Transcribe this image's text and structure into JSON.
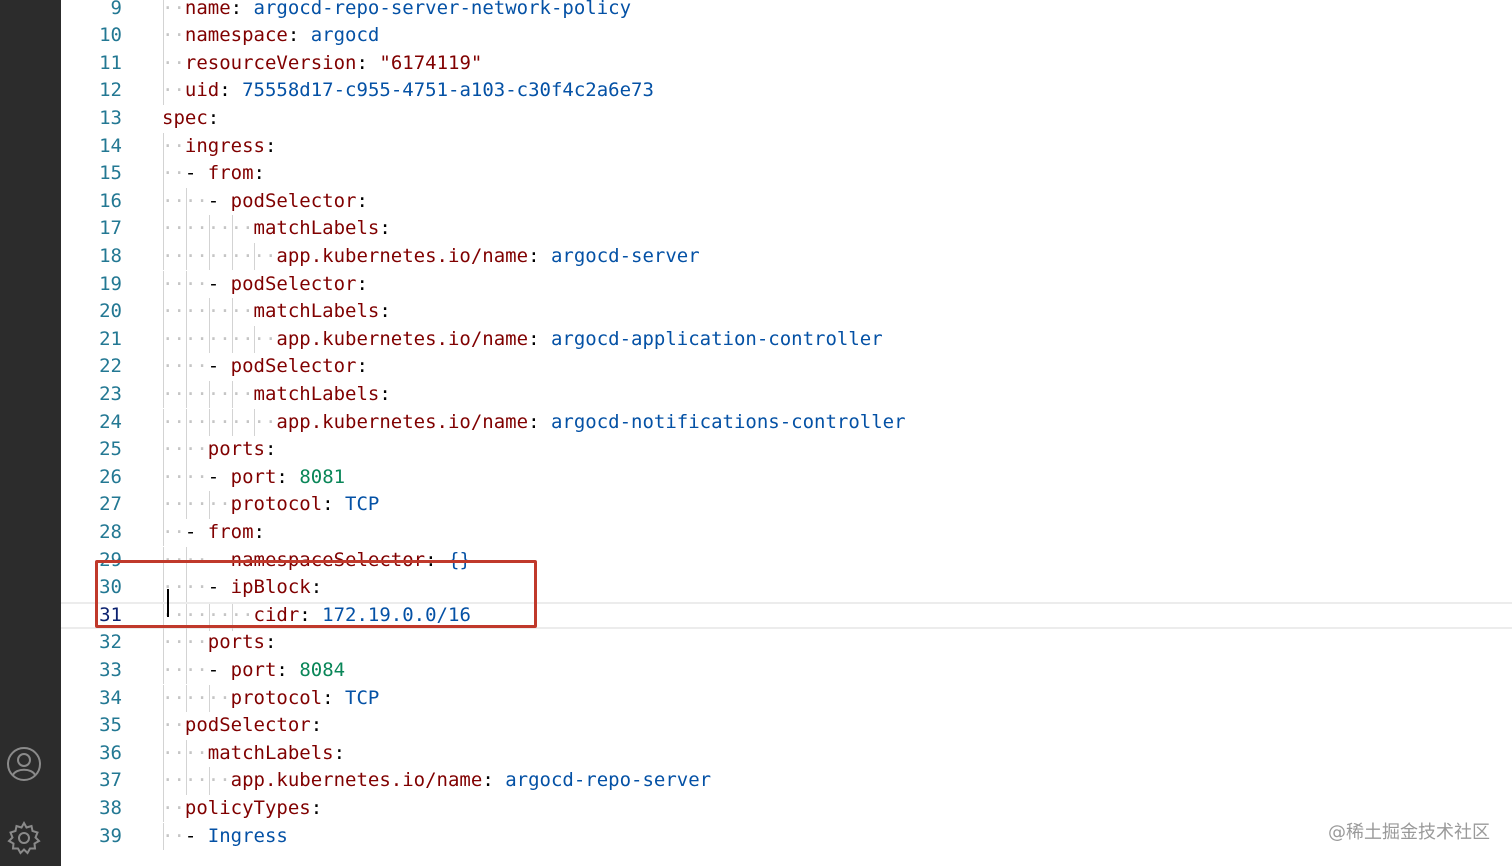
{
  "activity_bar": {
    "icons": [
      "account-icon",
      "settings-gear-icon"
    ]
  },
  "editor": {
    "current_line": 31,
    "lines": [
      {
        "num": "9",
        "indent": 1,
        "parts": [
          [
            "k",
            "name"
          ],
          [
            "p",
            ": "
          ],
          [
            "v",
            "argocd-repo-server-network-policy"
          ]
        ]
      },
      {
        "num": "10",
        "indent": 1,
        "parts": [
          [
            "k",
            "namespace"
          ],
          [
            "p",
            ": "
          ],
          [
            "v",
            "argocd"
          ]
        ]
      },
      {
        "num": "11",
        "indent": 1,
        "parts": [
          [
            "k",
            "resourceVersion"
          ],
          [
            "p",
            ": "
          ],
          [
            "k",
            "\"6174119\""
          ]
        ]
      },
      {
        "num": "12",
        "indent": 1,
        "parts": [
          [
            "k",
            "uid"
          ],
          [
            "p",
            ": "
          ],
          [
            "v",
            "75558d17-c955-4751-a103-c30f4c2a6e73"
          ]
        ]
      },
      {
        "num": "13",
        "indent": 0,
        "parts": [
          [
            "k",
            "spec"
          ],
          [
            "p",
            ":"
          ]
        ]
      },
      {
        "num": "14",
        "indent": 1,
        "parts": [
          [
            "k",
            "ingress"
          ],
          [
            "p",
            ":"
          ]
        ]
      },
      {
        "num": "15",
        "indent": 1,
        "parts": [
          [
            "p",
            "- "
          ],
          [
            "k",
            "from"
          ],
          [
            "p",
            ":"
          ]
        ]
      },
      {
        "num": "16",
        "indent": 2,
        "parts": [
          [
            "p",
            "- "
          ],
          [
            "k",
            "podSelector"
          ],
          [
            "p",
            ":"
          ]
        ]
      },
      {
        "num": "17",
        "indent": 4,
        "parts": [
          [
            "k",
            "matchLabels"
          ],
          [
            "p",
            ":"
          ]
        ]
      },
      {
        "num": "18",
        "indent": 5,
        "parts": [
          [
            "k",
            "app.kubernetes.io/name"
          ],
          [
            "p",
            ": "
          ],
          [
            "v",
            "argocd-server"
          ]
        ]
      },
      {
        "num": "19",
        "indent": 2,
        "parts": [
          [
            "p",
            "- "
          ],
          [
            "k",
            "podSelector"
          ],
          [
            "p",
            ":"
          ]
        ]
      },
      {
        "num": "20",
        "indent": 4,
        "parts": [
          [
            "k",
            "matchLabels"
          ],
          [
            "p",
            ":"
          ]
        ]
      },
      {
        "num": "21",
        "indent": 5,
        "parts": [
          [
            "k",
            "app.kubernetes.io/name"
          ],
          [
            "p",
            ": "
          ],
          [
            "v",
            "argocd-application-controller"
          ]
        ]
      },
      {
        "num": "22",
        "indent": 2,
        "parts": [
          [
            "p",
            "- "
          ],
          [
            "k",
            "podSelector"
          ],
          [
            "p",
            ":"
          ]
        ]
      },
      {
        "num": "23",
        "indent": 4,
        "parts": [
          [
            "k",
            "matchLabels"
          ],
          [
            "p",
            ":"
          ]
        ]
      },
      {
        "num": "24",
        "indent": 5,
        "parts": [
          [
            "k",
            "app.kubernetes.io/name"
          ],
          [
            "p",
            ": "
          ],
          [
            "v",
            "argocd-notifications-controller"
          ]
        ]
      },
      {
        "num": "25",
        "indent": 2,
        "parts": [
          [
            "k",
            "ports"
          ],
          [
            "p",
            ":"
          ]
        ]
      },
      {
        "num": "26",
        "indent": 2,
        "parts": [
          [
            "p",
            "- "
          ],
          [
            "k",
            "port"
          ],
          [
            "p",
            ": "
          ],
          [
            "n",
            "8081"
          ]
        ]
      },
      {
        "num": "27",
        "indent": 3,
        "parts": [
          [
            "k",
            "protocol"
          ],
          [
            "p",
            ": "
          ],
          [
            "v",
            "TCP"
          ]
        ]
      },
      {
        "num": "28",
        "indent": 1,
        "parts": [
          [
            "p",
            "- "
          ],
          [
            "k",
            "from"
          ],
          [
            "p",
            ":"
          ]
        ]
      },
      {
        "num": "29",
        "indent": 2,
        "parts": [
          [
            "p",
            "- "
          ],
          [
            "k",
            "namespaceSelector"
          ],
          [
            "p",
            ": "
          ],
          [
            "v",
            "{}"
          ]
        ]
      },
      {
        "num": "30",
        "indent": 2,
        "parts": [
          [
            "p",
            "- "
          ],
          [
            "k",
            "ipBlock"
          ],
          [
            "p",
            ":"
          ]
        ]
      },
      {
        "num": "31",
        "indent": 4,
        "parts": [
          [
            "k",
            "cidr"
          ],
          [
            "p",
            ": "
          ],
          [
            "v",
            "172.19.0.0/16"
          ]
        ]
      },
      {
        "num": "32",
        "indent": 2,
        "parts": [
          [
            "k",
            "ports"
          ],
          [
            "p",
            ":"
          ]
        ]
      },
      {
        "num": "33",
        "indent": 2,
        "parts": [
          [
            "p",
            "- "
          ],
          [
            "k",
            "port"
          ],
          [
            "p",
            ": "
          ],
          [
            "n",
            "8084"
          ]
        ]
      },
      {
        "num": "34",
        "indent": 3,
        "parts": [
          [
            "k",
            "protocol"
          ],
          [
            "p",
            ": "
          ],
          [
            "v",
            "TCP"
          ]
        ]
      },
      {
        "num": "35",
        "indent": 1,
        "parts": [
          [
            "k",
            "podSelector"
          ],
          [
            "p",
            ":"
          ]
        ]
      },
      {
        "num": "36",
        "indent": 2,
        "parts": [
          [
            "k",
            "matchLabels"
          ],
          [
            "p",
            ":"
          ]
        ]
      },
      {
        "num": "37",
        "indent": 3,
        "parts": [
          [
            "k",
            "app.kubernetes.io/name"
          ],
          [
            "p",
            ": "
          ],
          [
            "v",
            "argocd-repo-server"
          ]
        ]
      },
      {
        "num": "38",
        "indent": 1,
        "parts": [
          [
            "k",
            "policyTypes"
          ],
          [
            "p",
            ":"
          ]
        ]
      },
      {
        "num": "39",
        "indent": 1,
        "parts": [
          [
            "p",
            "- "
          ],
          [
            "v",
            "Ingress"
          ]
        ]
      }
    ]
  },
  "annotation": {
    "highlight_color": "#c0392b",
    "highlighted_lines": [
      "30",
      "31"
    ]
  },
  "watermark": {
    "text": "@稀土掘金技术社区"
  }
}
